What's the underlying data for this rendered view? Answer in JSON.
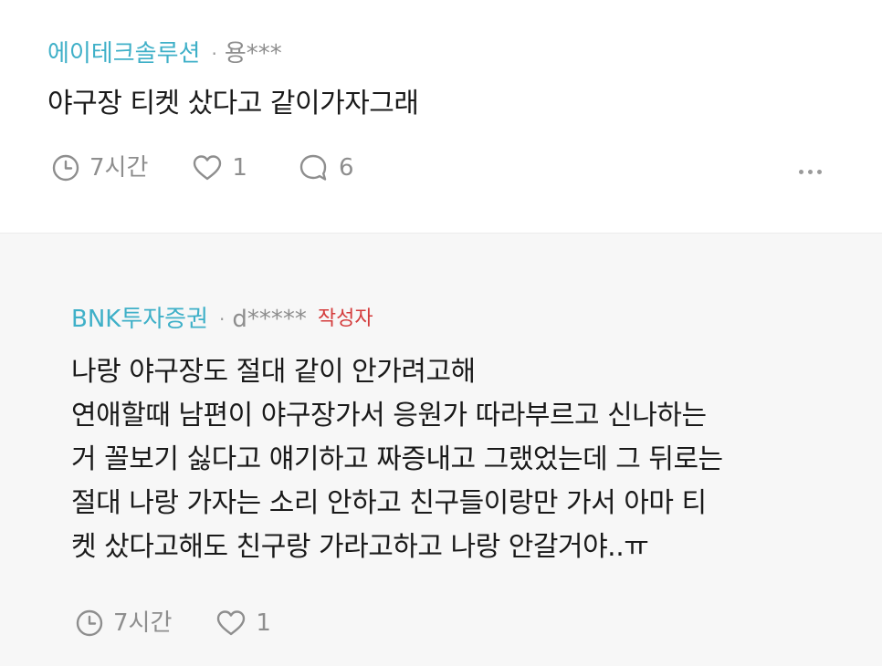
{
  "main_comment": {
    "author": "에이테크솔루션",
    "separator": "·",
    "user": "용***",
    "text": "야구장 티켓 샀다고 같이가자그래",
    "time": "7시간",
    "likes": "1",
    "replies": "6"
  },
  "reply": {
    "author": "BNK투자증권",
    "separator": "·",
    "user": "d*****",
    "badge": "작성자",
    "lines": [
      "나랑 야구장도 절대 같이 안가려고해",
      "연애할때 남편이 야구장가서 응원가 따라부르고 신나하는",
      "거 꼴보기 싫다고 얘기하고 짜증내고 그랬었는데 그 뒤로는",
      "절대 나랑 가자는 소리 안하고 친구들이랑만 가서 아마 티",
      "켓 샀다고해도 친구랑 가라고하고 나랑 안갈거야..ㅠ"
    ],
    "time": "7시간",
    "likes": "1"
  },
  "icons": {
    "clock": "clock-icon",
    "heart": "heart-icon",
    "comment": "comment-bubble-icon",
    "more": "more-horizontal-icon"
  },
  "colors": {
    "author": "#3fb0c8",
    "badge": "#d43c3c",
    "meta": "#8e8e8e",
    "reply_bg": "#f7f7f7"
  }
}
